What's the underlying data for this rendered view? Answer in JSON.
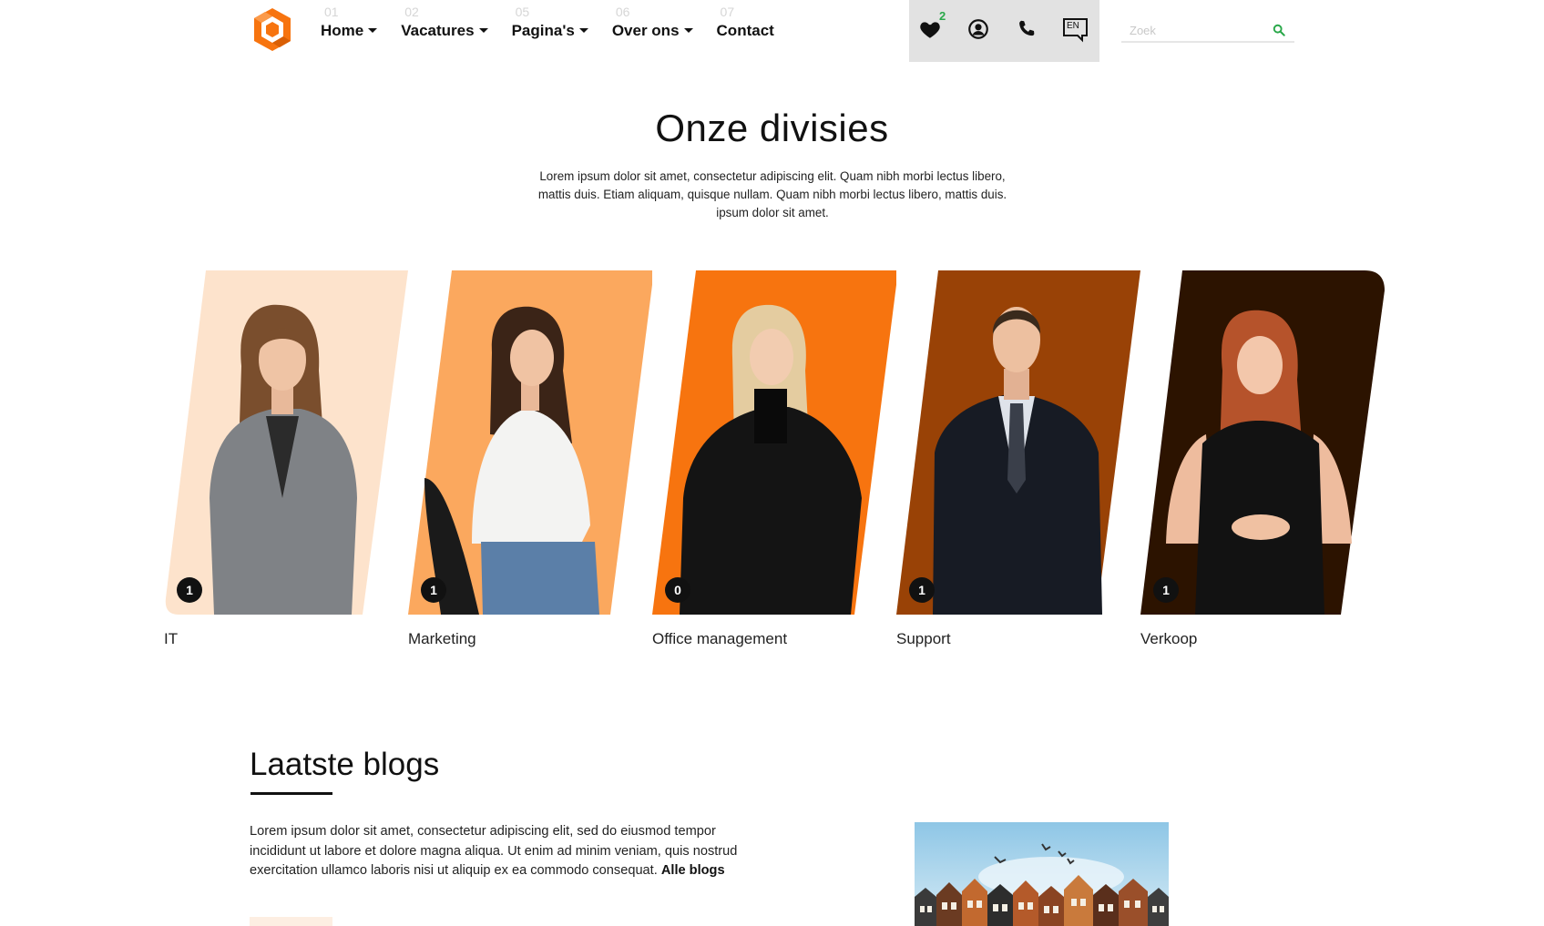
{
  "nav": {
    "items": [
      {
        "num": "01",
        "label": "Home",
        "dropdown": true
      },
      {
        "num": "02",
        "label": "Vacatures",
        "dropdown": true
      },
      {
        "num": "05",
        "label": "Pagina's",
        "dropdown": true
      },
      {
        "num": "06",
        "label": "Over ons",
        "dropdown": true
      },
      {
        "num": "07",
        "label": "Contact",
        "dropdown": false
      }
    ]
  },
  "header": {
    "favorites_count": "2",
    "language": "EN",
    "icons": [
      "heart-icon",
      "user-icon",
      "phone-icon",
      "language-icon"
    ]
  },
  "search": {
    "placeholder": "Zoek",
    "value": ""
  },
  "divisions": {
    "title": "Onze divisies",
    "description": "Lorem ipsum dolor sit amet, consectetur adipiscing elit. Quam nibh morbi lectus libero, mattis duis. Etiam aliquam, quisque nullam. Quam nibh morbi lectus libero, mattis duis. ipsum dolor sit amet.",
    "cards": [
      {
        "label": "IT",
        "count": "1",
        "color": "#fde3cc"
      },
      {
        "label": "Marketing",
        "count": "1",
        "color": "#fba85e"
      },
      {
        "label": "Office management",
        "count": "0",
        "color": "#f7740f"
      },
      {
        "label": "Support",
        "count": "1",
        "color": "#994206"
      },
      {
        "label": "Verkoop",
        "count": "1",
        "color": "#2c1300"
      }
    ]
  },
  "blogs": {
    "title": "Laatste blogs",
    "text": "Lorem ipsum dolor sit amet, consectetur adipiscing elit, sed do eiusmod tempor incididunt ut labore et dolore magna aliqua. Ut enim ad minim veniam, quis nostrud exercitation ullamco laboris nisi ut aliquip ex ea commodo consequat.",
    "link": "Alle blogs"
  },
  "colors": {
    "brand": "#f7740f",
    "badge_green": "#2aa84a",
    "icon_panel": "#e2e2e2"
  }
}
